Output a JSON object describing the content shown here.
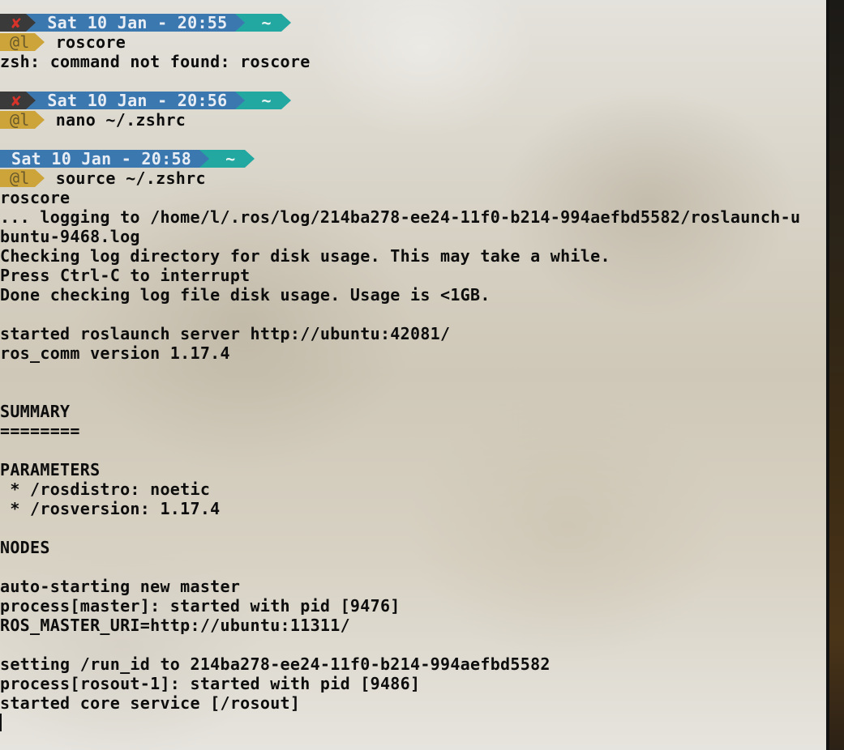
{
  "prompts": [
    {
      "status": "✘",
      "date": "Sat 10 Jan - 20:55",
      "dir": "~",
      "user": "@l",
      "command": "roscore"
    },
    {
      "status": "✘",
      "date": "Sat 10 Jan - 20:56",
      "dir": "~",
      "user": "@l",
      "command": "nano ~/.zshrc"
    },
    {
      "status": "",
      "date": "Sat 10 Jan - 20:58",
      "dir": "~",
      "user": "@l",
      "command": "source ~/.zshrc"
    }
  ],
  "output": {
    "error_line": "zsh: command not found: roscore",
    "lines": [
      "roscore",
      "... logging to /home/l/.ros/log/214ba278-ee24-11f0-b214-994aefbd5582/roslaunch-u",
      "buntu-9468.log",
      "Checking log directory for disk usage. This may take a while.",
      "Press Ctrl-C to interrupt",
      "Done checking log file disk usage. Usage is <1GB.",
      "",
      "started roslaunch server http://ubuntu:42081/",
      "ros_comm version 1.17.4",
      "",
      "",
      "SUMMARY",
      "========",
      "",
      "PARAMETERS",
      " * /rosdistro: noetic",
      " * /rosversion: 1.17.4",
      "",
      "NODES",
      "",
      "auto-starting new master",
      "process[master]: started with pid [9476]",
      "ROS_MASTER_URI=http://ubuntu:11311/",
      "",
      "setting /run_id to 214ba278-ee24-11f0-b214-994aefbd5582",
      "process[rosout-1]: started with pid [9486]",
      "started core service [/rosout]"
    ]
  }
}
